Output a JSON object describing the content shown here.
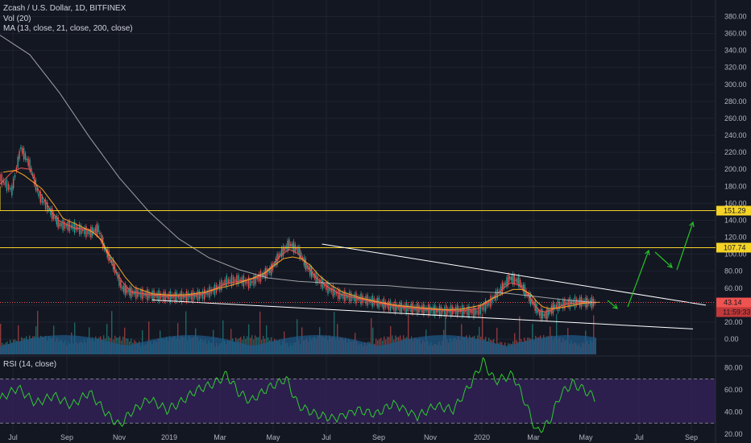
{
  "header": {
    "title": "Zcash / U.S. Dollar, 1D, BITFINEX",
    "vol": "Vol (20)",
    "ma": "MA (13, close, 21, close, 200, close)",
    "rsi": "RSI (14, close)"
  },
  "colors": {
    "bg": "#131722",
    "grid": "#1f2330",
    "up": "#26a69a",
    "down": "#ef5350",
    "ma13": "#ef5350",
    "ma21": "#f9a825",
    "ma200": "#cfcfcf",
    "hline": "#f5d327",
    "rsi": "#2ecc2e",
    "rsiBand": "#3b2466",
    "arrow": "#26c026",
    "trend": "#ffffff",
    "priceLine": "#ef5350"
  },
  "chart_data": {
    "type": "candlestick",
    "title": "Zcash / U.S. Dollar, 1D, BITFINEX",
    "x_ticks": [
      "Jul",
      "Sep",
      "Nov",
      "2019",
      "Mar",
      "May",
      "Jul",
      "Sep",
      "Nov",
      "2020",
      "Mar",
      "May",
      "Jul",
      "Sep"
    ],
    "y_ticks": [
      "380.00",
      "360.00",
      "340.00",
      "320.00",
      "300.00",
      "280.00",
      "260.00",
      "240.00",
      "220.00",
      "200.00",
      "180.00",
      "160.00",
      "140.00",
      "120.00",
      "100.00",
      "80.00",
      "60.00",
      "40.00",
      "20.00",
      "0.00"
    ],
    "ylim": [
      0,
      390
    ],
    "price_path": [
      [
        0,
        190
      ],
      [
        0.02,
        175
      ],
      [
        0.035,
        225
      ],
      [
        0.05,
        205
      ],
      [
        0.065,
        170
      ],
      [
        0.085,
        150
      ],
      [
        0.1,
        135
      ],
      [
        0.125,
        132
      ],
      [
        0.15,
        125
      ],
      [
        0.165,
        130
      ],
      [
        0.175,
        108
      ],
      [
        0.19,
        88
      ],
      [
        0.205,
        60
      ],
      [
        0.22,
        55
      ],
      [
        0.25,
        52
      ],
      [
        0.28,
        50
      ],
      [
        0.31,
        50
      ],
      [
        0.34,
        52
      ],
      [
        0.36,
        58
      ],
      [
        0.38,
        68
      ],
      [
        0.4,
        70
      ],
      [
        0.42,
        66
      ],
      [
        0.44,
        75
      ],
      [
        0.455,
        82
      ],
      [
        0.47,
        100
      ],
      [
        0.485,
        112
      ],
      [
        0.5,
        105
      ],
      [
        0.515,
        85
      ],
      [
        0.53,
        72
      ],
      [
        0.55,
        60
      ],
      [
        0.57,
        52
      ],
      [
        0.6,
        48
      ],
      [
        0.63,
        44
      ],
      [
        0.66,
        38
      ],
      [
        0.7,
        36
      ],
      [
        0.74,
        33
      ],
      [
        0.77,
        34
      ],
      [
        0.8,
        32
      ],
      [
        0.82,
        42
      ],
      [
        0.84,
        58
      ],
      [
        0.855,
        72
      ],
      [
        0.87,
        68
      ],
      [
        0.885,
        52
      ],
      [
        0.895,
        42
      ],
      [
        0.905,
        30
      ],
      [
        0.915,
        28
      ],
      [
        0.93,
        38
      ],
      [
        0.95,
        42
      ],
      [
        0.97,
        44
      ],
      [
        0.985,
        43
      ],
      [
        1.0,
        43.14
      ]
    ],
    "current_price": "43.14",
    "current_time": "11:59:33",
    "levels": [
      {
        "label": "151.29",
        "value": 151.29
      },
      {
        "label": "107.74",
        "value": 107.74
      }
    ],
    "indicators": [
      "Vol (20)",
      "MA (13, close, 21, close, 200, close)",
      "RSI (14, close)"
    ],
    "rsi": {
      "y_ticks": [
        "80.00",
        "60.00",
        "40.00",
        "20.00"
      ],
      "ylim": [
        15,
        90
      ],
      "band": [
        30,
        70
      ],
      "path": [
        [
          0,
          52
        ],
        [
          0.03,
          62
        ],
        [
          0.06,
          48
        ],
        [
          0.09,
          55
        ],
        [
          0.12,
          46
        ],
        [
          0.15,
          58
        ],
        [
          0.18,
          38
        ],
        [
          0.2,
          28
        ],
        [
          0.22,
          40
        ],
        [
          0.25,
          52
        ],
        [
          0.28,
          42
        ],
        [
          0.3,
          48
        ],
        [
          0.33,
          60
        ],
        [
          0.36,
          66
        ],
        [
          0.38,
          74
        ],
        [
          0.4,
          58
        ],
        [
          0.42,
          50
        ],
        [
          0.45,
          62
        ],
        [
          0.48,
          70
        ],
        [
          0.5,
          46
        ],
        [
          0.53,
          38
        ],
        [
          0.56,
          34
        ],
        [
          0.6,
          42
        ],
        [
          0.63,
          38
        ],
        [
          0.66,
          48
        ],
        [
          0.7,
          36
        ],
        [
          0.73,
          46
        ],
        [
          0.76,
          42
        ],
        [
          0.79,
          66
        ],
        [
          0.81,
          86
        ],
        [
          0.83,
          68
        ],
        [
          0.86,
          74
        ],
        [
          0.88,
          50
        ],
        [
          0.9,
          22
        ],
        [
          0.92,
          30
        ],
        [
          0.94,
          56
        ],
        [
          0.96,
          66
        ],
        [
          0.98,
          60
        ],
        [
          1.0,
          52
        ]
      ]
    }
  }
}
